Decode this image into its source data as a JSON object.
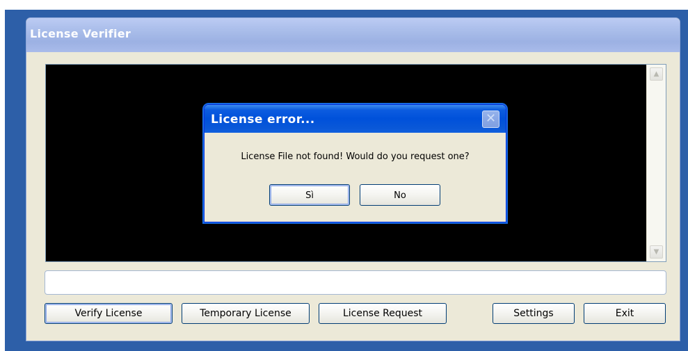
{
  "window": {
    "title": "License Verifier"
  },
  "status_field": {
    "value": ""
  },
  "buttons": {
    "verify": "Verify License",
    "temporary": "Temporary License",
    "request": "License Request",
    "settings": "Settings",
    "exit": "Exit"
  },
  "dialog": {
    "title": "License error...",
    "message": "License File not found! Would do you request one?",
    "yes": "Sì",
    "no": "No",
    "close_glyph": "✕"
  },
  "scrollbar": {
    "up_glyph": "▲",
    "down_glyph": "▼"
  },
  "colors": {
    "frame": "#2d5fa8",
    "window_bg": "#ece9d8",
    "console_bg": "#000000",
    "dialog_titlebar": "#0051da"
  }
}
